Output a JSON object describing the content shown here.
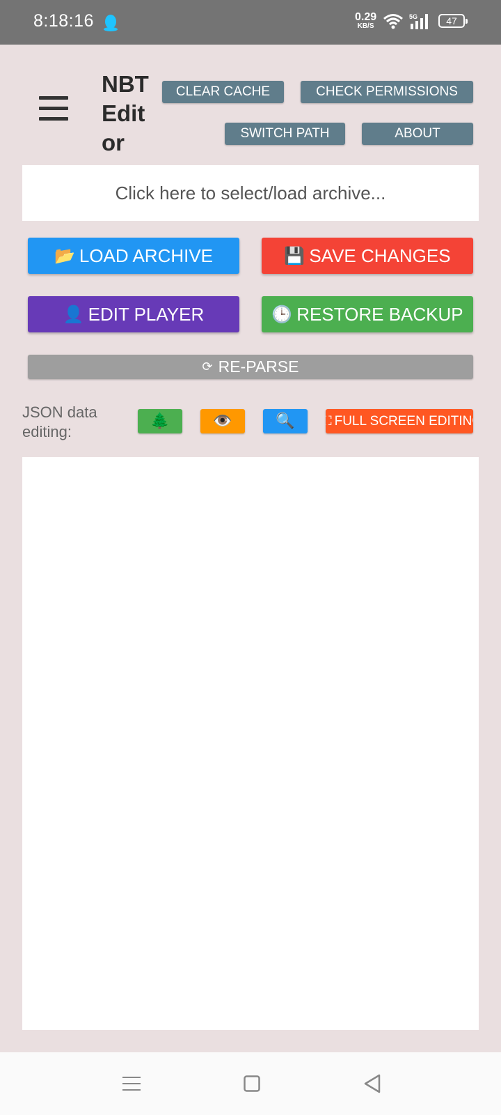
{
  "status_bar": {
    "time": "8:18:16",
    "net_speed_value": "0.29",
    "net_speed_unit": "KB/S",
    "signal_label": "5G",
    "battery": "47"
  },
  "header": {
    "title": "NBT Edit or",
    "buttons": {
      "clear_cache": "CLEAR CACHE",
      "check_permissions": "CHECK PERMISSIONS",
      "switch_path": "SWITCH PATH",
      "about": "ABOUT"
    }
  },
  "archive_selector": {
    "placeholder": "Click here to select/load archive..."
  },
  "actions": {
    "load_archive": {
      "icon": "📂",
      "label": "LOAD ARCHIVE",
      "color": "#2196f3"
    },
    "save_changes": {
      "icon": "💾",
      "label": "SAVE CHANGES",
      "color": "#f44336"
    },
    "edit_player": {
      "icon": "👤",
      "label": "EDIT PLAYER",
      "color": "#673ab7"
    },
    "restore_backup": {
      "icon": "🕒",
      "label": "RESTORE BACKUP",
      "color": "#4caf50"
    },
    "reparse": {
      "icon": "⟳",
      "label": "RE-PARSE",
      "color": "#9e9e9e"
    }
  },
  "json_editing": {
    "label": "JSON data editing:",
    "tree_icon": "🌲",
    "view_icon": "👁️",
    "search_icon": "🔍",
    "fullscreen_icon": "⛶",
    "fullscreen_label": "FULL SCREEN EDITING"
  },
  "colors": {
    "background": "#eadfe0",
    "status_bar": "#747474",
    "small_button": "#607d8b",
    "tree_button": "#4caf50",
    "view_button": "#ff9800",
    "search_button": "#2196f3",
    "fullscreen_button": "#ff5722"
  }
}
